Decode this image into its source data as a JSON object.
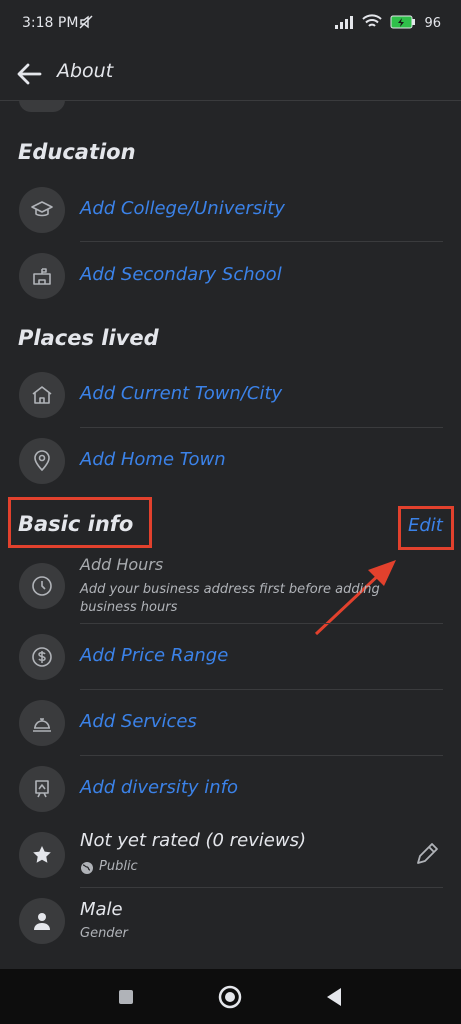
{
  "status": {
    "time": "3:18 PM",
    "battery": "96"
  },
  "header": {
    "title": "About"
  },
  "education": {
    "title": "Education",
    "items": [
      {
        "label": "Add College/University"
      },
      {
        "label": "Add Secondary School"
      }
    ]
  },
  "places": {
    "title": "Places lived",
    "items": [
      {
        "label": "Add Current Town/City"
      },
      {
        "label": "Add Home Town"
      }
    ]
  },
  "basic": {
    "title": "Basic info",
    "edit_label": "Edit",
    "hours": {
      "label": "Add Hours",
      "sub": "Add your business address first before adding business hours"
    },
    "price": {
      "label": "Add Price Range"
    },
    "services": {
      "label": "Add Services"
    },
    "diversity": {
      "label": "Add diversity info"
    },
    "rating": {
      "label": "Not yet rated (0 reviews)",
      "privacy": "Public"
    },
    "gender": {
      "label": "Male",
      "sub": "Gender"
    }
  },
  "colors": {
    "accent": "#3b82e8",
    "highlight": "#e2412d",
    "background": "#242527"
  }
}
